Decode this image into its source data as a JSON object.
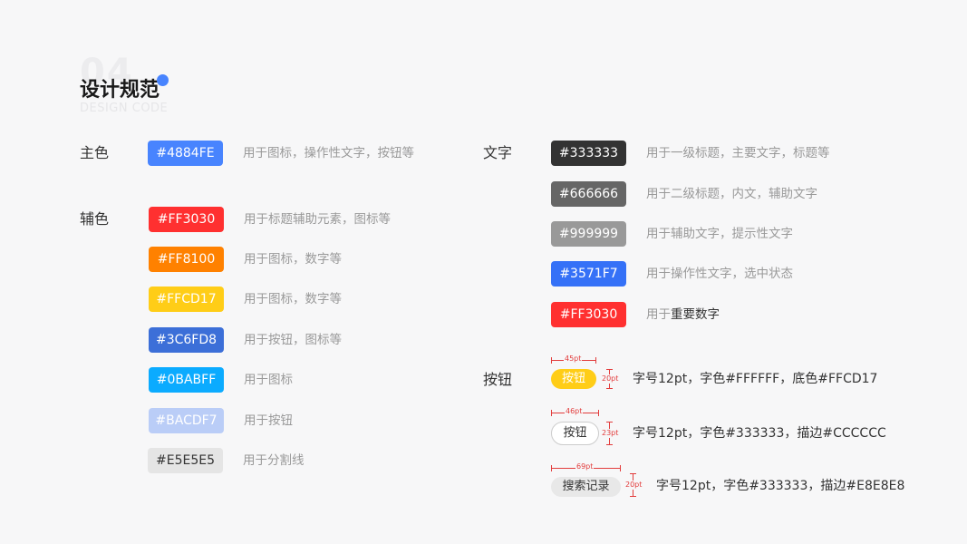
{
  "header": {
    "number": "04",
    "title": "设计规范",
    "subtitle": "DESIGN CODE",
    "accent_color": "#4884FE"
  },
  "primary": {
    "label": "主色",
    "color": "#4884FE",
    "hex": "#4884FE",
    "desc": "用于图标，操作性文字，按钮等"
  },
  "auxiliary": {
    "label": "辅色",
    "items": [
      {
        "hex": "#FF3030",
        "color": "#FF3030",
        "text_color": "#FFFFFF",
        "desc": "用于标题辅助元素，图标等"
      },
      {
        "hex": "#FF8100",
        "color": "#FF8100",
        "text_color": "#FFFFFF",
        "desc": "用于图标，数字等"
      },
      {
        "hex": "#FFCD17",
        "color": "#FFCD17",
        "text_color": "#FFFFFF",
        "desc": "用于图标，数字等"
      },
      {
        "hex": "#3C6FD8",
        "color": "#3C6FD8",
        "text_color": "#FFFFFF",
        "desc": "用于按钮，图标等"
      },
      {
        "hex": "#0BABFF",
        "color": "#0BABFF",
        "text_color": "#FFFFFF",
        "desc": "用于图标"
      },
      {
        "hex": "#BACDF7",
        "color": "#BACDF7",
        "text_color": "#FFFFFF",
        "desc": "用于按钮"
      },
      {
        "hex": "#E5E5E5",
        "color": "#E5E5E5",
        "text_color": "#333333",
        "desc": "用于分割线"
      }
    ]
  },
  "text_colors": {
    "label": "文字",
    "items": [
      {
        "hex": "#333333",
        "color": "#333333",
        "desc_prefix": "用于",
        "desc_em": "",
        "desc_rest": "一级标题，主要文字，标题等"
      },
      {
        "hex": "#666666",
        "color": "#666666",
        "desc_prefix": "用于",
        "desc_em": "",
        "desc_rest": "二级标题，内文，辅助文字"
      },
      {
        "hex": "#999999",
        "color": "#999999",
        "desc_prefix": "用于",
        "desc_em": "",
        "desc_rest": "辅助文字，提示性文字"
      },
      {
        "hex": "#3571F7",
        "color": "#3571F7",
        "desc_prefix": "用于",
        "desc_em": "",
        "desc_rest": "操作性文字，选中状态"
      },
      {
        "hex": "#FF3030",
        "color": "#FF3030",
        "desc_prefix": "用于",
        "desc_em": "重要数字",
        "desc_rest": ""
      }
    ]
  },
  "buttons": {
    "label": "按钮",
    "items": [
      {
        "text": "按钮",
        "width_label": "45pt",
        "height_label": "20pt",
        "desc": "字号12pt，字色#FFFFFF，底色#FFCD17"
      },
      {
        "text": "按钮",
        "width_label": "46pt",
        "height_label": "23pt",
        "desc": "字号12pt，字色#333333，描边#CCCCCC"
      },
      {
        "text": "搜索记录",
        "width_label": "69pt",
        "height_label": "20pt",
        "desc": "字号12pt，字色#333333，描边#E8E8E8"
      }
    ]
  }
}
